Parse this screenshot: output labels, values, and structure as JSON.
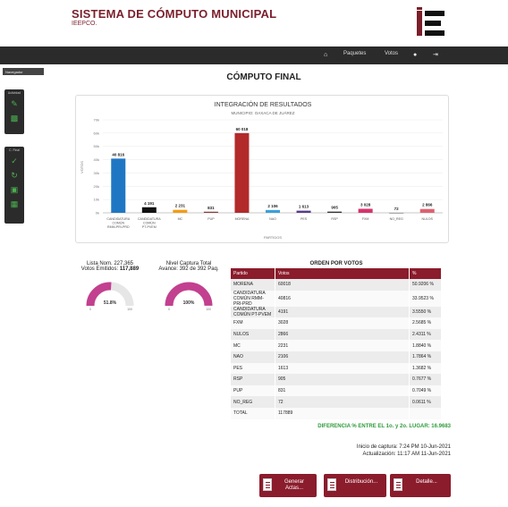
{
  "header": {
    "title": "SISTEMA DE CÓMPUTO MUNICIPAL",
    "subtitle": "IEEPCO."
  },
  "nav": {
    "home_icon": "home-icon",
    "paquetes": "Paquetes",
    "votos": "Votos",
    "user_icon": "user-icon",
    "logout_icon": "logout-icon"
  },
  "sidebar": {
    "tab_label": "Navegador",
    "panel1_header": "Actividad",
    "panel2_header": "C. Final",
    "colors": {
      "icon": "#4caf50",
      "panel": "#2b2b2b"
    }
  },
  "page_title": "CÓMPUTO FINAL",
  "chart_data": {
    "type": "bar",
    "title": "INTEGRACIÓN DE RESULTADOS",
    "subtitle": "MUNICIPIO: OAXACA DE JUÁREZ",
    "xlabel": "PARTIDOS",
    "ylabel": "VOTOS",
    "ylim": [
      0,
      70000
    ],
    "yticks": [
      "0k",
      "10k",
      "20k",
      "30k",
      "40k",
      "50k",
      "60k",
      "70k"
    ],
    "categories": [
      "CANDIDATURA COMÚN RMM-PRI-PRD",
      "CANDIDATURA COMÚN PT-PVEM",
      "MC",
      "PUP",
      "MORENA",
      "NAO",
      "PES",
      "RSP",
      "FXM",
      "NO_REG",
      "NULOS"
    ],
    "values": [
      40816,
      4191,
      2231,
      831,
      60018,
      2106,
      1613,
      905,
      3028,
      72,
      2866
    ],
    "labels": [
      "40 816",
      "4 191",
      "2 231",
      "831",
      "60 018",
      "2 106",
      "1 613",
      "905",
      "3 028",
      "72",
      "2 866"
    ],
    "colors": [
      "#1f77c4",
      "#111111",
      "#f39c12",
      "#8b3a3a",
      "#b22a2a",
      "#3aa0d8",
      "#5a3a8a",
      "#333333",
      "#d6336c",
      "#aaaaaa",
      "#e06070"
    ]
  },
  "gauges": [
    {
      "line1": "Lista Nom. 227,365",
      "line2_prefix": "Votos Emitidos: ",
      "line2_value": "117,889",
      "value_text": "51.8%",
      "value": 0.518,
      "min": "0",
      "max": "100"
    },
    {
      "line1": "Nivel Captura Total",
      "line2_prefix": "Avance: 392 de 392 Paq.",
      "line2_value": "",
      "value_text": "100%",
      "value": 1.0,
      "min": "0",
      "max": "100"
    }
  ],
  "table": {
    "title": "ORDEN POR VOTOS",
    "headers": [
      "Partido",
      "Votos",
      "%"
    ],
    "rows": [
      [
        "MORENA",
        "60018",
        "50.9206 %"
      ],
      [
        "CANDIDATURA COMÚN RMM-PRI-PRD",
        "40816",
        "33.9523 %"
      ],
      [
        "CANDIDATURA COMÚN PT-PVEM",
        "4191",
        "3.5550 %"
      ],
      [
        "FXM",
        "3028",
        "2.5685 %"
      ],
      [
        "NULOS",
        "2866",
        "2.4311 %"
      ],
      [
        "MC",
        "2231",
        "1.8840 %"
      ],
      [
        "NAO",
        "2106",
        "1.7864 %"
      ],
      [
        "PES",
        "1613",
        "1.3682 %"
      ],
      [
        "RSP",
        "905",
        "0.7677 %"
      ],
      [
        "PUP",
        "831",
        "0.7049 %"
      ],
      [
        "NO_REG",
        "72",
        "0.0611 %"
      ],
      [
        "TOTAL",
        "117889",
        ""
      ]
    ]
  },
  "diff_text": "DIFERENCIA % ENTRE EL 1o. y 2o. LUGAR: 16.9683",
  "times": {
    "inicio": "Inicio de captura: 7:24 PM 10-Jun-2021",
    "actualizacion": "Actualización: 11:17 AM 11-Jun-2021"
  },
  "buttons": {
    "generar": "Generar Actas...",
    "distribucion": "Distribución...",
    "detalle": "Detalle..."
  },
  "colors": {
    "brand": "#7a1f2b",
    "table_header": "#8b1c2c",
    "gauge": "#c2408f",
    "diff": "#2e9b3a"
  }
}
